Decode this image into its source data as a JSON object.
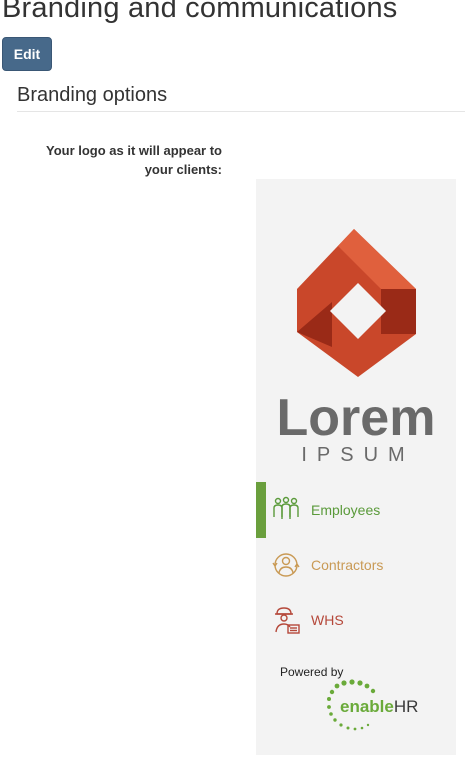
{
  "page": {
    "title": "Branding and communications",
    "edit_label": "Edit"
  },
  "branding": {
    "section_title": "Branding options",
    "logo_label": "Your logo as it will appear to your clients:",
    "logo": {
      "brand_name": "Lorem",
      "brand_sub": "IPSUM",
      "colors": {
        "primary": "#c9472a",
        "shadow": "#9a2a17",
        "text": "#6a6a6a"
      }
    },
    "nav_items": [
      {
        "label": "Employees",
        "icon": "people-group-icon",
        "color": "#5a9a3a",
        "active": true
      },
      {
        "label": "Contractors",
        "icon": "contractor-person-icon",
        "color": "#c99a55",
        "active": false
      },
      {
        "label": "WHS",
        "icon": "hardhat-worker-icon",
        "color": "#b5483a",
        "active": false
      }
    ],
    "powered_by": {
      "label": "Powered by",
      "brand": "enableHR",
      "brand_parts": {
        "prefix": "enable",
        "suffix": "HR"
      },
      "brand_color": "#6aaa3a",
      "text_color": "#3a3a3a"
    },
    "accent_color": "#6a9f3d",
    "panel_color": "#f3f3f3",
    "button_color": "#47698a"
  }
}
